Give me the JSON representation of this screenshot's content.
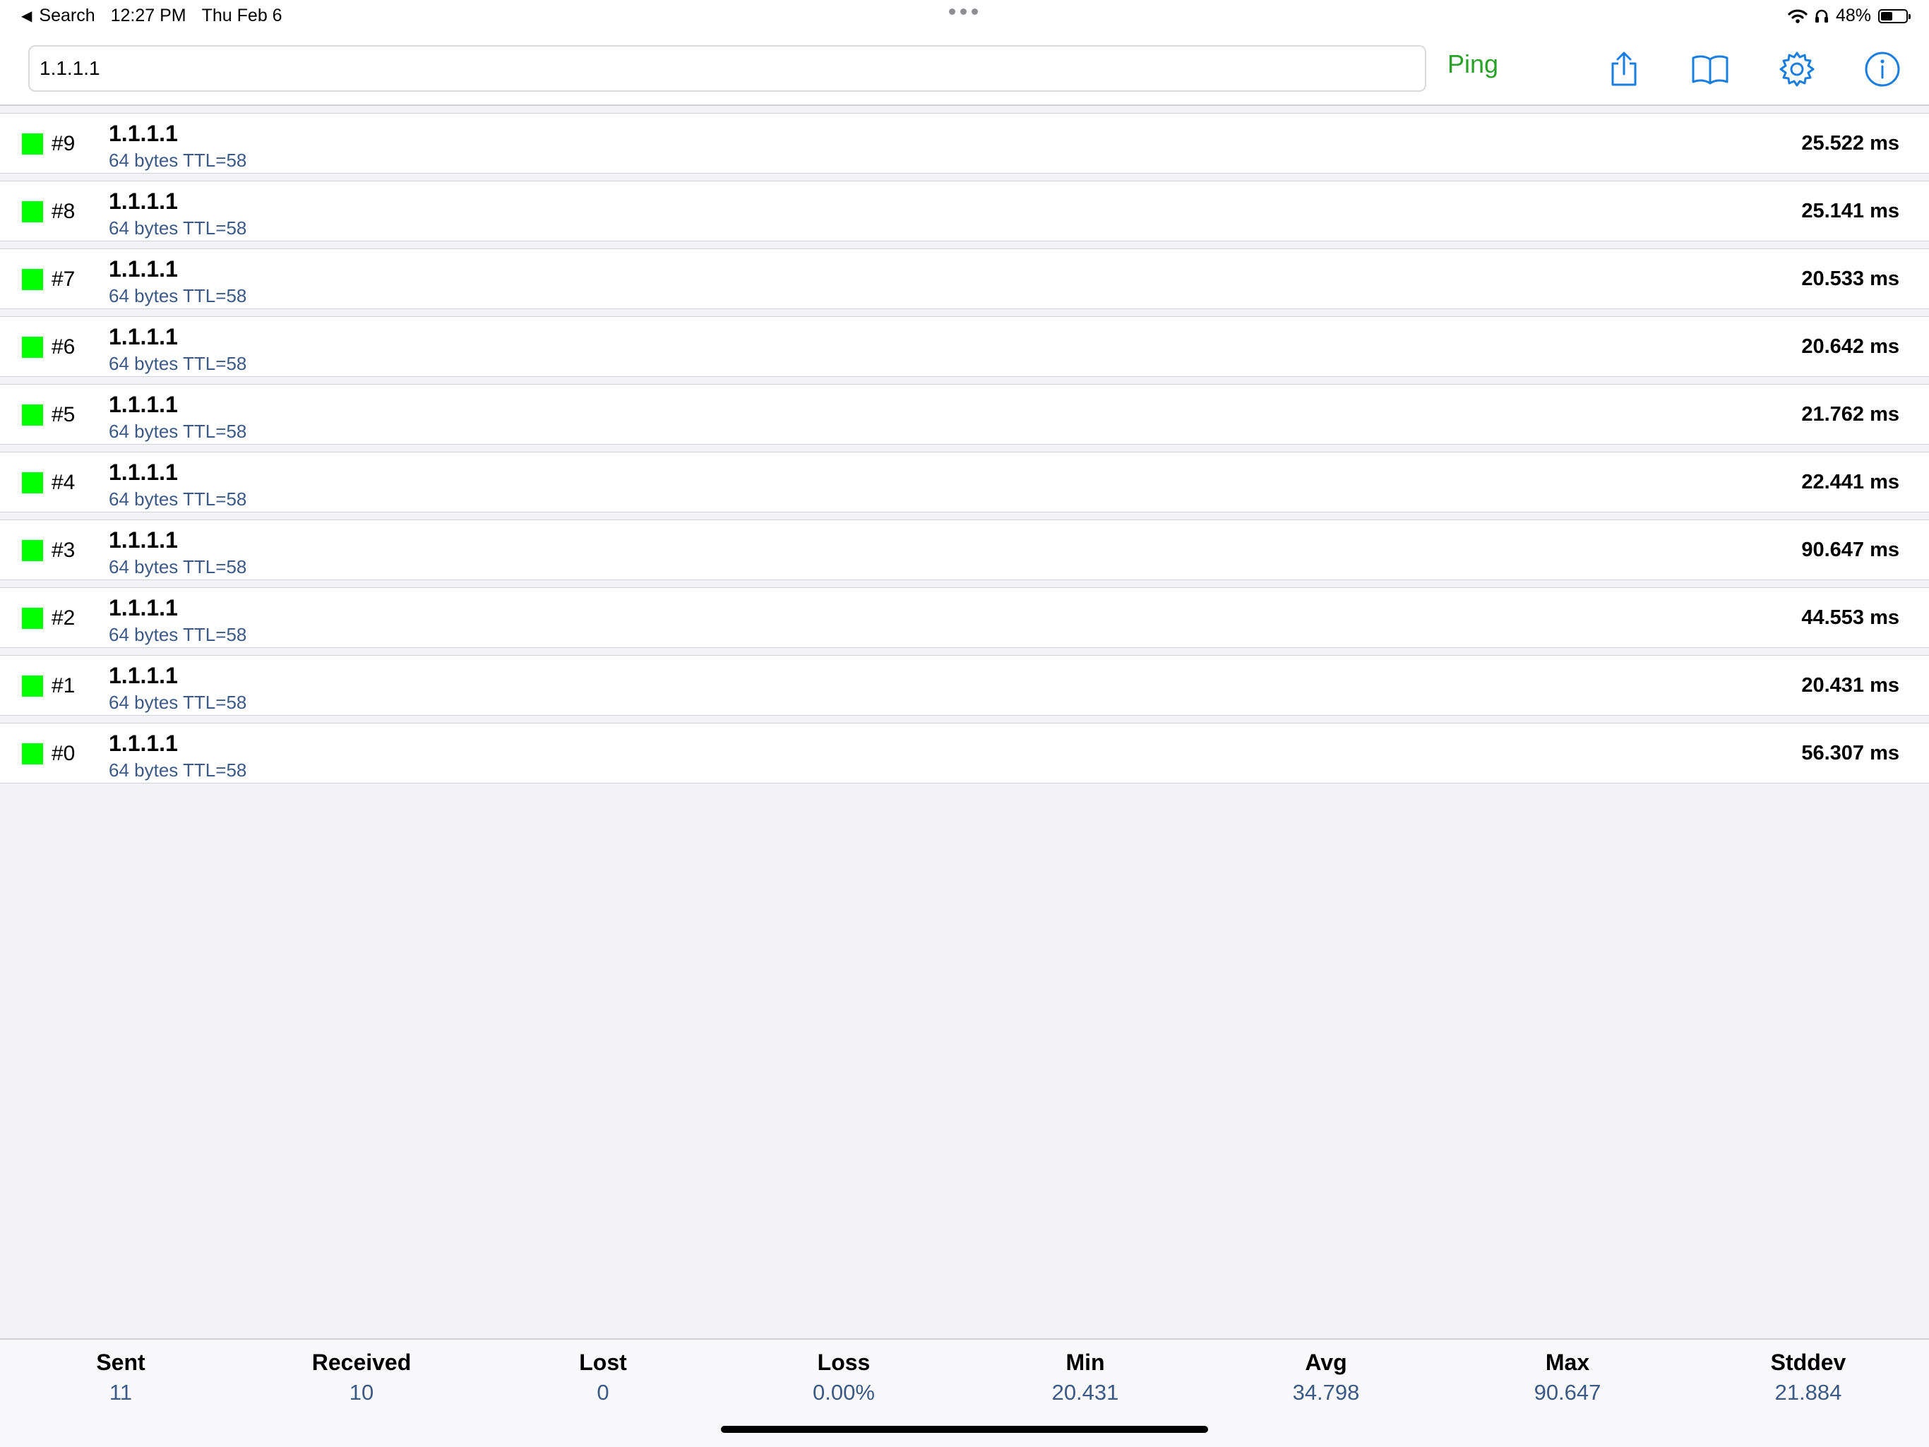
{
  "status_bar": {
    "back_label": "Search",
    "time": "12:27 PM",
    "date": "Thu Feb 6",
    "battery": "48%",
    "battery_level": 0.48
  },
  "toolbar": {
    "host_value": "1.1.1.1",
    "ping_label": "Ping",
    "icons": [
      "share-icon",
      "book-icon",
      "gear-icon",
      "info-icon"
    ],
    "accent_color": "#1a7de0",
    "ping_color": "#2aa22a"
  },
  "results": [
    {
      "seq": "#9",
      "host": "1.1.1.1",
      "detail": "64 bytes TTL=58",
      "time": "25.522 ms",
      "status_color": "#00ff00"
    },
    {
      "seq": "#8",
      "host": "1.1.1.1",
      "detail": "64 bytes TTL=58",
      "time": "25.141 ms",
      "status_color": "#00ff00"
    },
    {
      "seq": "#7",
      "host": "1.1.1.1",
      "detail": "64 bytes TTL=58",
      "time": "20.533 ms",
      "status_color": "#00ff00"
    },
    {
      "seq": "#6",
      "host": "1.1.1.1",
      "detail": "64 bytes TTL=58",
      "time": "20.642 ms",
      "status_color": "#00ff00"
    },
    {
      "seq": "#5",
      "host": "1.1.1.1",
      "detail": "64 bytes TTL=58",
      "time": "21.762 ms",
      "status_color": "#00ff00"
    },
    {
      "seq": "#4",
      "host": "1.1.1.1",
      "detail": "64 bytes TTL=58",
      "time": "22.441 ms",
      "status_color": "#00ff00"
    },
    {
      "seq": "#3",
      "host": "1.1.1.1",
      "detail": "64 bytes TTL=58",
      "time": "90.647 ms",
      "status_color": "#00ff00"
    },
    {
      "seq": "#2",
      "host": "1.1.1.1",
      "detail": "64 bytes TTL=58",
      "time": "44.553 ms",
      "status_color": "#00ff00"
    },
    {
      "seq": "#1",
      "host": "1.1.1.1",
      "detail": "64 bytes TTL=58",
      "time": "20.431 ms",
      "status_color": "#00ff00"
    },
    {
      "seq": "#0",
      "host": "1.1.1.1",
      "detail": "64 bytes TTL=58",
      "time": "56.307 ms",
      "status_color": "#00ff00"
    }
  ],
  "stats": [
    {
      "label": "Sent",
      "value": "11"
    },
    {
      "label": "Received",
      "value": "10"
    },
    {
      "label": "Lost",
      "value": "0"
    },
    {
      "label": "Loss",
      "value": "0.00%"
    },
    {
      "label": "Min",
      "value": "20.431"
    },
    {
      "label": "Avg",
      "value": "34.798"
    },
    {
      "label": "Max",
      "value": "90.647"
    },
    {
      "label": "Stddev",
      "value": "21.884"
    }
  ]
}
